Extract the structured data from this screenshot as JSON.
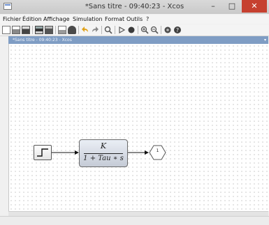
{
  "window": {
    "title": "*Sans titre - 09:40:23 - Xcos",
    "minimize_glyph": "–",
    "maximize_glyph": "□",
    "close_glyph": "✕"
  },
  "menu": [
    "Fichier",
    "Édition",
    "Affichage",
    "Simulation",
    "Format",
    "Outils",
    "?"
  ],
  "toolbar_icons": [
    "new-icon",
    "open-icon",
    "open-folder-icon",
    "save-icon",
    "save-as-icon",
    "print-icon",
    "export-icon",
    "undo-icon",
    "redo-icon",
    "fit-diagram-icon",
    "start-icon",
    "stop-icon",
    "zoom-in-icon",
    "zoom-out-icon",
    "xcos-demos-icon",
    "help-icon"
  ],
  "diagram_tab": {
    "label": "*Sans titre - 09:40:23 - Xcos",
    "menu_glyph": "▾"
  },
  "blocks": {
    "step": {
      "name": "STEP_FUNCTION"
    },
    "clr": {
      "numerator": "K",
      "denominator": "1 + Tau ∗ s"
    },
    "out": {
      "label": "1"
    }
  },
  "colors": {
    "title_close": "#c6402f",
    "tab_background": "#7f9dc4",
    "block_fill": "#c5cbd6"
  }
}
